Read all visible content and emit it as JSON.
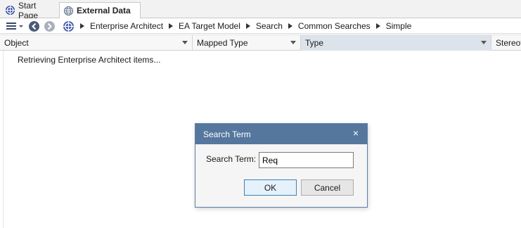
{
  "tabs": [
    {
      "label": "Start Page",
      "active": false,
      "icon": "ea-logo-icon"
    },
    {
      "label": "External Data",
      "active": true,
      "icon": "globe-icon"
    }
  ],
  "toolbar": {
    "icons": [
      "hamburger-menu-icon",
      "back-icon",
      "forward-icon",
      "ea-logo-icon"
    ],
    "breadcrumb": [
      "Enterprise Architect",
      "EA Target Model",
      "Search",
      "Common Searches",
      "Simple"
    ]
  },
  "columns": [
    {
      "label": "Object"
    },
    {
      "label": "Mapped Type"
    },
    {
      "label": "Type"
    },
    {
      "label": "Stereot"
    }
  ],
  "status": {
    "text": "Retrieving Enterprise Architect items..."
  },
  "dialog": {
    "title": "Search Term",
    "close": "×",
    "label": "Search Term:",
    "value": "Req",
    "ok_label": "OK",
    "cancel_label": "Cancel"
  },
  "colors": {
    "dialog_title_bg": "#55779e",
    "selected_column_bg": "#dde3ea",
    "ok_border": "#3c7fb1"
  }
}
